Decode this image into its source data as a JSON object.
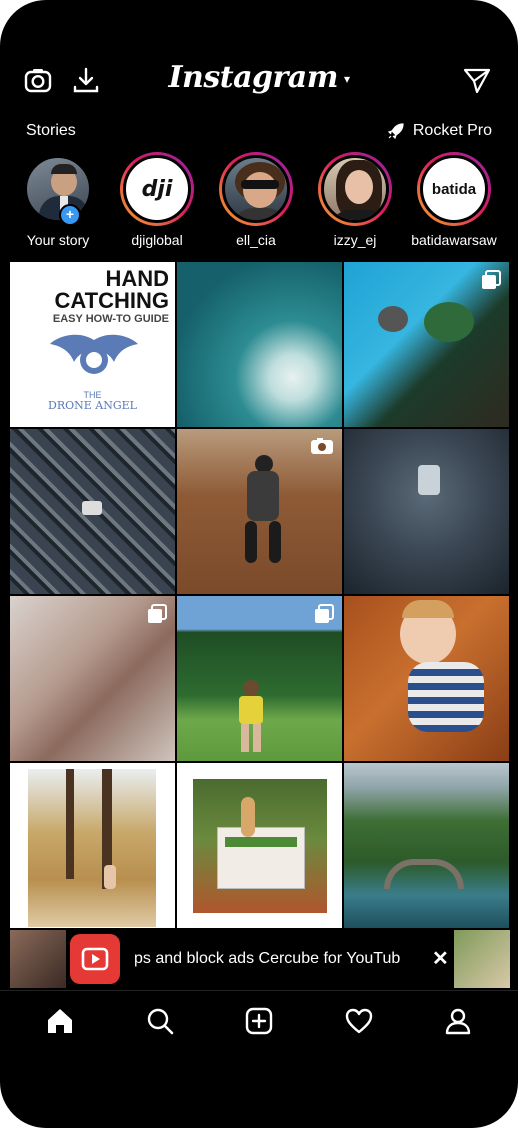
{
  "header": {
    "title": "Instagram",
    "caret": "▾",
    "icons": [
      "camera-icon",
      "download-icon",
      "send-icon"
    ]
  },
  "stories": {
    "label": "Stories",
    "rocket_label": "Rocket Pro",
    "items": [
      {
        "username": "Your story"
      },
      {
        "username": "djiglobal",
        "avatar_text": "dji"
      },
      {
        "username": "ell_cia"
      },
      {
        "username": "izzy_ej"
      },
      {
        "username": "batidawarsaw",
        "avatar_text": "batida"
      }
    ]
  },
  "grid": {
    "post1_text_line1": "HAND",
    "post1_text_line2": "CATCHING",
    "post1_text_line3": "EASY HOW-TO GUIDE",
    "post1_text_line4": "THE",
    "post1_text_line5": "DRONE ANGEL"
  },
  "banner": {
    "text": "ps and block ads Cercube for YouTub",
    "close": "✕"
  },
  "navbar": {
    "items": [
      "home-icon",
      "search-icon",
      "add-post-icon",
      "activity-icon",
      "profile-icon"
    ]
  },
  "colors": {
    "background": "#000000",
    "story_ring_start": "#f9a825",
    "story_ring_end": "#8e24aa",
    "badge_blue": "#3897f0",
    "youtube_red": "#e53935"
  }
}
